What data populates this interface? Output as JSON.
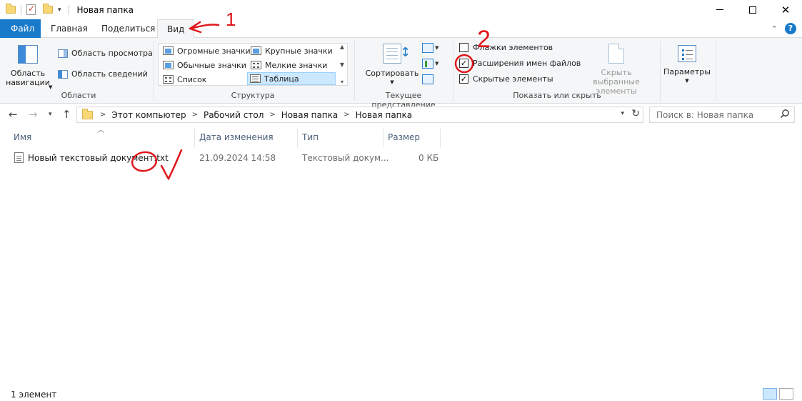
{
  "window": {
    "title": "Новая папка",
    "controls": {
      "minimize": "—",
      "maximize": "□",
      "close": "✕"
    }
  },
  "ribbon_tabs": [
    {
      "label": "Файл"
    },
    {
      "label": "Главная"
    },
    {
      "label": "Поделиться"
    },
    {
      "label": "Вид",
      "active": true
    }
  ],
  "ribbon": {
    "panes": {
      "navigation_pane": "Область навигации",
      "preview_pane": "Область просмотра",
      "details_pane": "Область сведений",
      "group_label": "Области"
    },
    "layout": {
      "items": [
        "Огромные значки",
        "Крупные значки",
        "Обычные значки",
        "Мелкие значки",
        "Список",
        "Таблица"
      ],
      "selected": "Таблица",
      "group_label": "Структура"
    },
    "current_view": {
      "sort_by": "Сортировать",
      "group_label": "Текущее представление"
    },
    "show_hide": {
      "item_checkboxes": {
        "label": "Флажки элементов",
        "checked": false
      },
      "file_name_extensions": {
        "label": "Расширения имен файлов",
        "checked": true
      },
      "hidden_items": {
        "label": "Скрытые элементы",
        "checked": true
      },
      "hide_selected": "Скрыть выбранные элементы",
      "group_label": "Показать или скрыть"
    },
    "options": "Параметры"
  },
  "address_bar": {
    "breadcrumbs": [
      "Этот компьютер",
      "Рабочий стол",
      "Новая папка",
      "Новая папка"
    ]
  },
  "search": {
    "placeholder": "Поиск в: Новая папка"
  },
  "file_list": {
    "columns": [
      "Имя",
      "Дата изменения",
      "Тип",
      "Размер"
    ],
    "rows": [
      {
        "name": "Новый текстовый документ.txt",
        "modified": "21.09.2024 14:58",
        "type": "Текстовый докум...",
        "size": "0 КБ"
      }
    ]
  },
  "status_bar": {
    "item_count": "1 элемент"
  },
  "annotations": {
    "mark_1": "1",
    "mark_2": "2",
    "color": "#e0161b"
  },
  "colors": {
    "file_tab": "#1979ca",
    "ribbon_bg": "#f5f6f7",
    "selection": "#cce8ff"
  }
}
